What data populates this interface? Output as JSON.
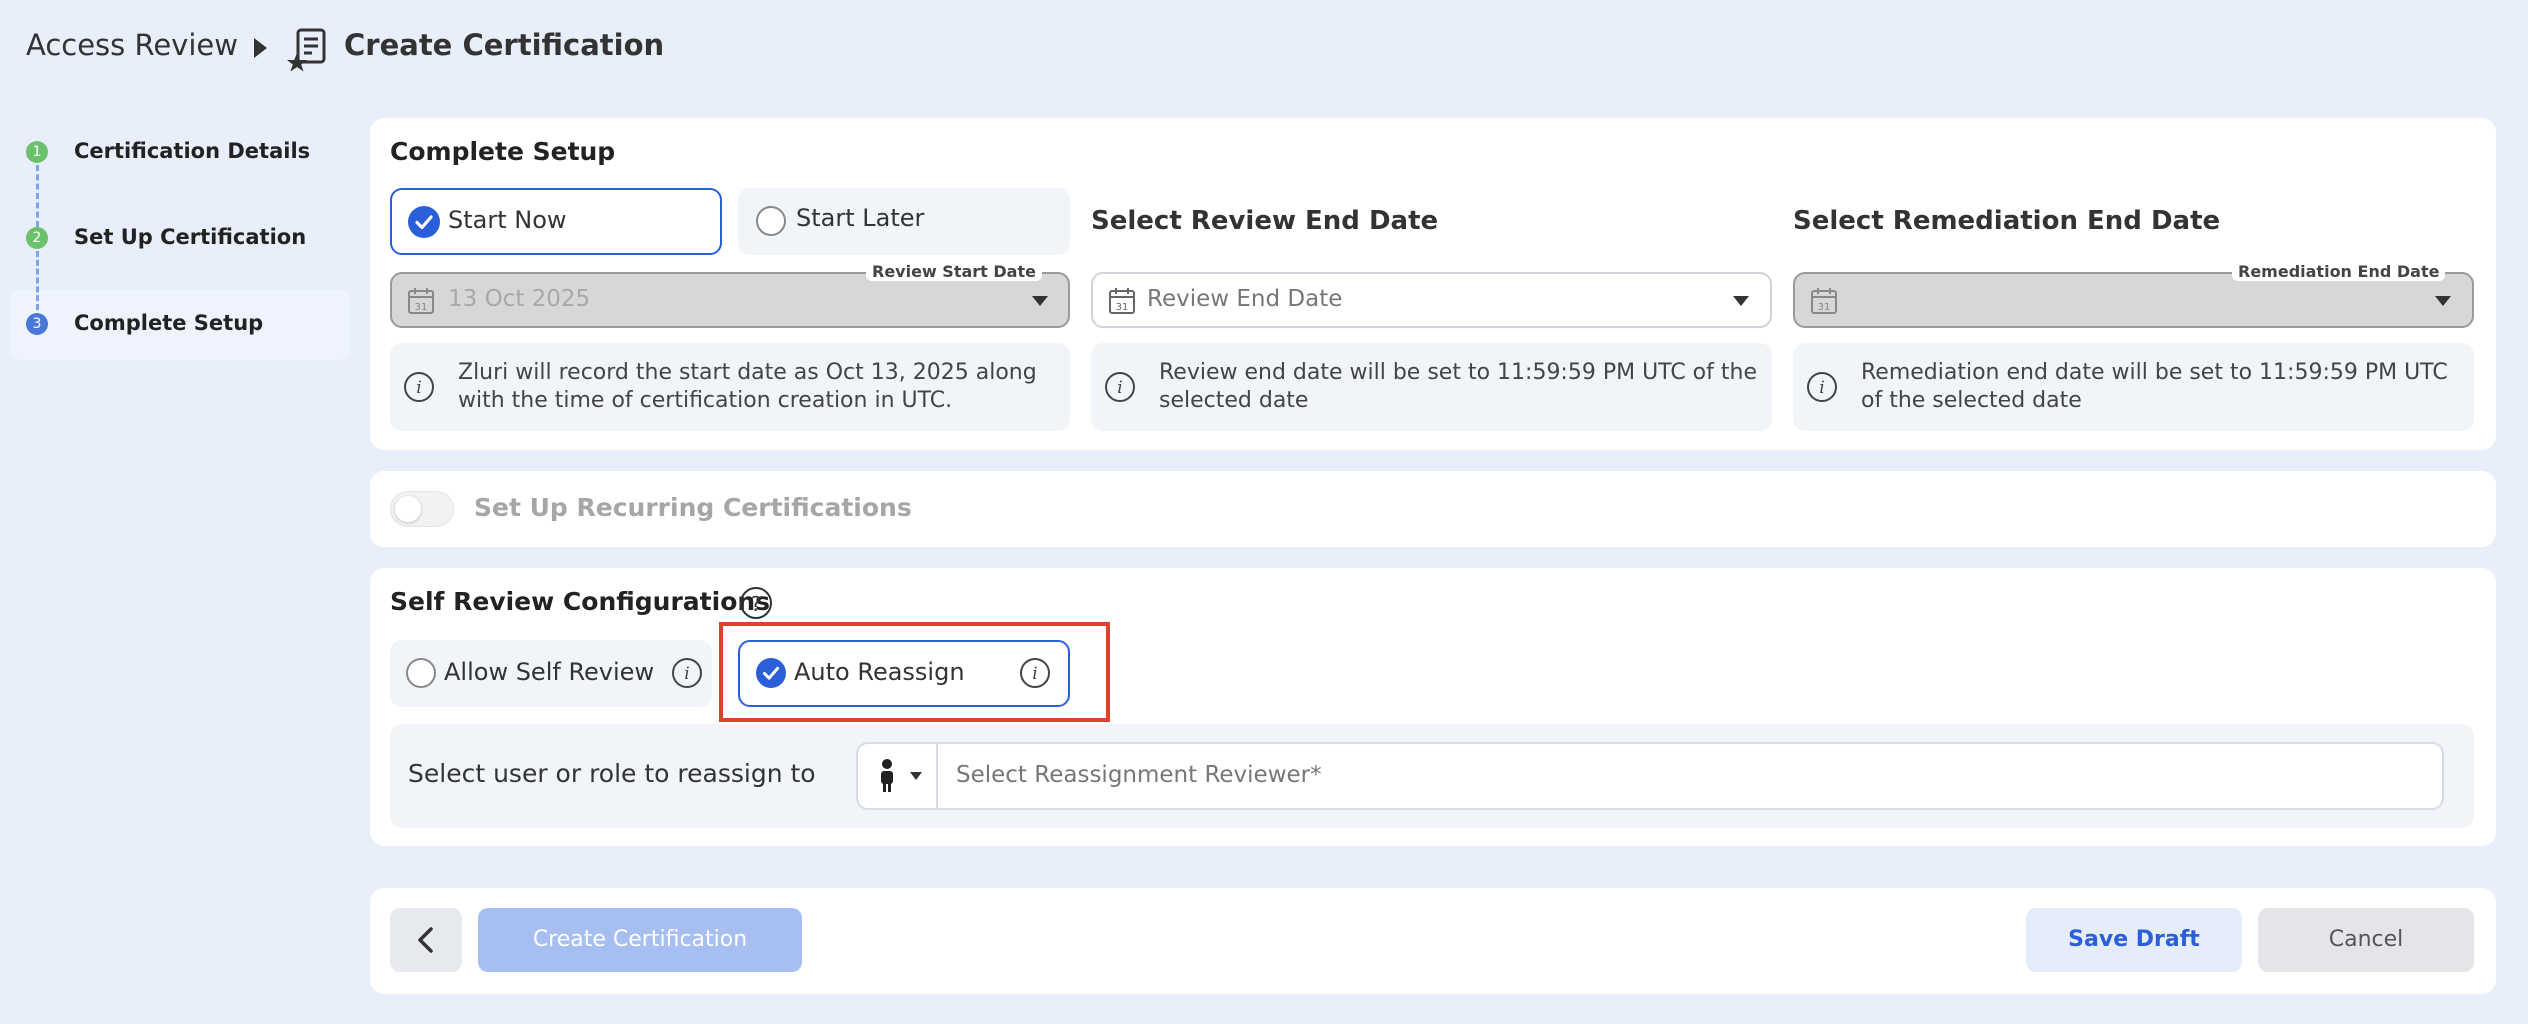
{
  "header": {
    "breadcrumb_root": "Access Review",
    "title": "Create Certification"
  },
  "stepper": {
    "steps": [
      {
        "number": "1",
        "label": "Certification Details",
        "status": "done"
      },
      {
        "number": "2",
        "label": "Set Up Certification",
        "status": "done"
      },
      {
        "number": "3",
        "label": "Complete Setup",
        "status": "active"
      }
    ]
  },
  "setup": {
    "title": "Complete Setup",
    "start_now_label": "Start Now",
    "start_later_label": "Start Later",
    "selected_start": "Start Now",
    "review_start_date_label": "Review Start Date",
    "review_start_date_value": "13 Oct 2025",
    "start_info": "Zluri will record the start date as Oct 13, 2025 along with the time of certification creation in UTC.",
    "review_end_title": "Select Review End Date",
    "review_end_placeholder": "Review End Date",
    "review_end_info": "Review end date will be set to 11:59:59 PM UTC of the selected date",
    "remediation_title": "Select Remediation End Date",
    "remediation_label": "Remediation End Date",
    "remediation_info": "Remediation end date will be set to 11:59:59 PM UTC of the selected date"
  },
  "recurring": {
    "label": "Set Up Recurring Certifications",
    "enabled": false
  },
  "self_review": {
    "title": "Self Review Configurations",
    "help_icon": "?",
    "allow_label": "Allow Self Review",
    "auto_reassign_label": "Auto Reassign",
    "selected": "Auto Reassign",
    "reassign_to_label": "Select user or role to reassign to",
    "reviewer_placeholder": "Select Reassignment Reviewer*"
  },
  "footer": {
    "create_label": "Create Certification",
    "save_draft_label": "Save Draft",
    "cancel_label": "Cancel"
  },
  "icons": {
    "info": "i",
    "calendar_day": "31"
  },
  "colors": {
    "accent": "#2b5fd9",
    "step_done": "#6cc26a",
    "highlight": "#e0412e"
  }
}
